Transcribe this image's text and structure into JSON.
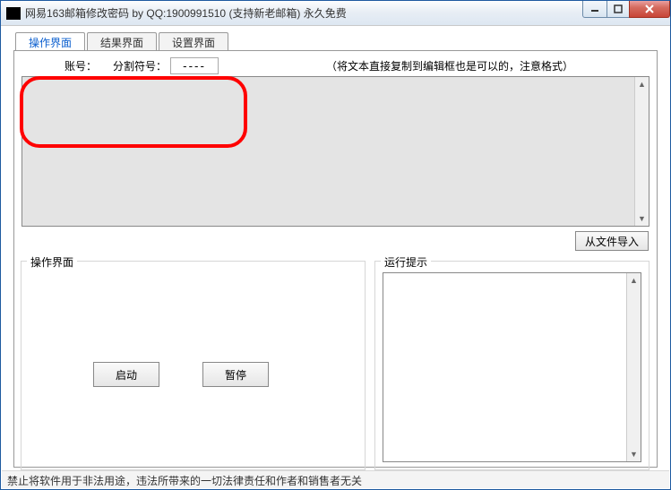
{
  "window": {
    "title": "网易163邮箱修改密码 by QQ:1900991510 (支持新老邮箱) 永久免费"
  },
  "tabs": {
    "t1": "操作界面",
    "t2": "结果界面",
    "t3": "设置界面"
  },
  "top": {
    "account_label": "账号：",
    "delimiter_label": "分割符号：",
    "delimiter_value": "----",
    "hint": "（将文本直接复制到编辑框也是可以的，注意格式）"
  },
  "buttons": {
    "import": "从文件导入",
    "start": "启动",
    "pause": "暂停"
  },
  "groups": {
    "ops": "操作界面",
    "run": "运行提示"
  },
  "status": {
    "text": "禁止将软件用于非法用途，违法所带来的一切法律责任和作者和销售者无关"
  }
}
